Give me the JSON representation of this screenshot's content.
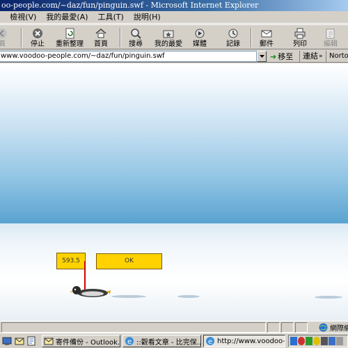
{
  "window": {
    "title": "oo-people.com/~daz/fun/pinguin.swf - Microsoft Internet Explorer"
  },
  "menu": {
    "items": [
      ")",
      "檢視(V)",
      "我的最愛(A)",
      "工具(T)",
      "說明(H)"
    ]
  },
  "toolbar": {
    "back_label": "頁",
    "stop_label": "停止",
    "refresh_label": "重新整理",
    "home_label": "首頁",
    "search_label": "搜尋",
    "favorites_label": "我的最愛",
    "media_label": "媒體",
    "history_label": "記錄",
    "mail_label": "郵件",
    "print_label": "列印",
    "edit_label": "編輯"
  },
  "address": {
    "url": "www.voodoo-people.com/~daz/fun/pinguin.swf",
    "go_label": "移至",
    "links_label": "連結",
    "norton_label": "Norton"
  },
  "game": {
    "score": "593.5",
    "ok_label": "OK"
  },
  "status": {
    "zone_label": "網際網"
  },
  "taskbar": {
    "tasks": [
      "寄件備份 - Outlook...",
      "::觀看文章 - 比完保...",
      "http://www.voodoo-p..."
    ]
  },
  "colors": {
    "title_bar": "#0a246a",
    "game_button": "#ffd200",
    "pole": "#d00000",
    "sky": "#3d8fc2"
  }
}
